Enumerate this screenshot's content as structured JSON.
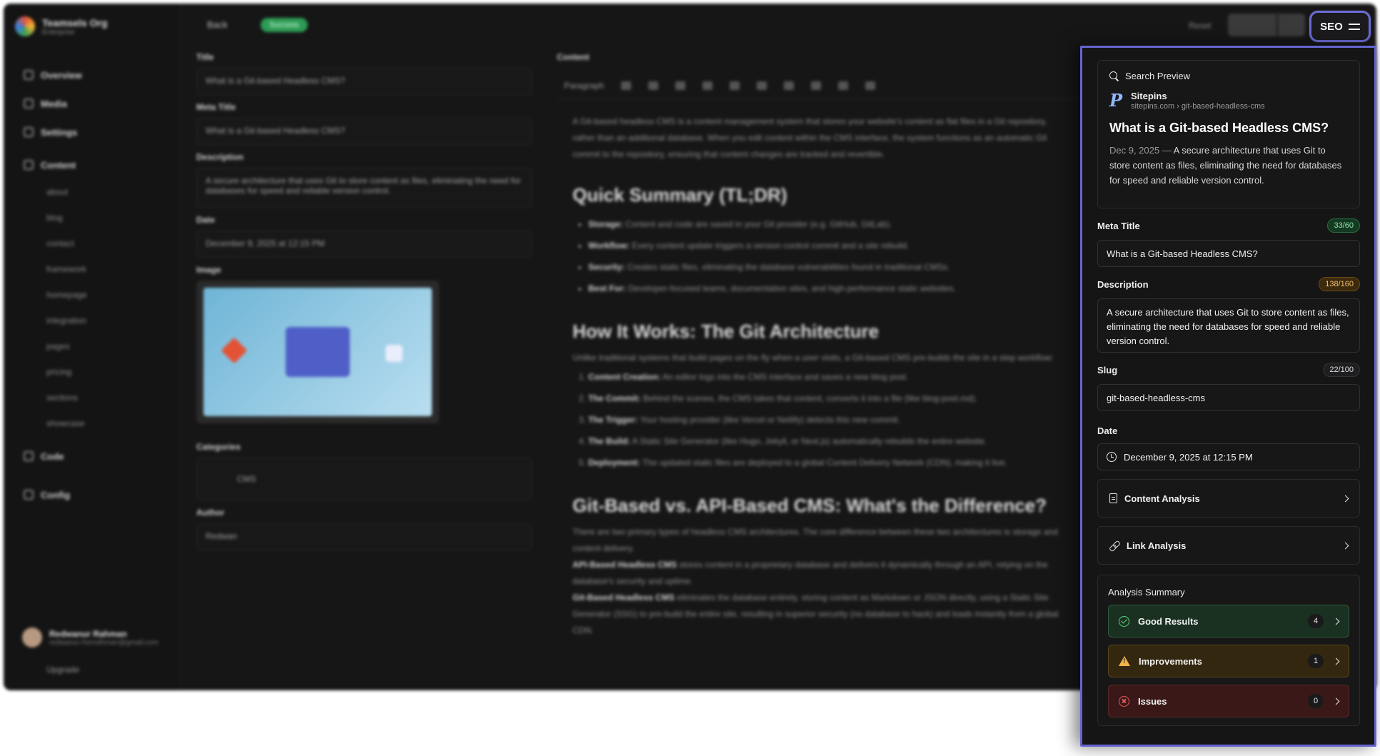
{
  "background": {
    "org_name": "Teamsels Org",
    "org_plan": "Enterprise",
    "nav": [
      "Overview",
      "Media",
      "Settings",
      "Content"
    ],
    "content_pages": [
      "about",
      "blog",
      "contact",
      "framework",
      "homepage",
      "integration",
      "pages",
      "pricing",
      "sections",
      "showcase"
    ],
    "nav_bottom": [
      "Code",
      "Config"
    ],
    "user_name": "Redwanur Rahman",
    "user_email": "redwanur.rhemdhman@gmail.com",
    "upgrade": "Upgrade",
    "back": "Back",
    "status": "Success",
    "reset": "Reset",
    "form": {
      "title_label": "Title",
      "title_value": "What is a Git-based Headless CMS?",
      "meta_title_label": "Meta Title",
      "meta_title_value": "What is a Git-based Headless CMS?",
      "description_label": "Description",
      "description_value": "A secure architecture that uses Git to store content as files, eliminating the need for databases for speed and reliable version control.",
      "date_label": "Date",
      "date_value": "December 9, 2025 at 12:15 PM",
      "image_label": "Image",
      "categories_label": "Categories",
      "category_value": "CMS",
      "author_label": "Author",
      "author_value": "Redwan"
    },
    "editor": {
      "content_label": "Content",
      "paragraph": "Paragraph",
      "intro": "A Git-based headless CMS is a content management system that stores your website's content as flat files in a Git repository, rather than an additional database. When you edit content within the CMS interface, the system functions as an automatic Git commit to the repository, ensuring that content changes are tracked and revertible.",
      "h_summary": "Quick Summary (TL;DR)",
      "summary_items": [
        {
          "k": "Storage:",
          "v": "Content and code are saved in your Git provider (e.g. GitHub, GitLab)."
        },
        {
          "k": "Workflow:",
          "v": "Every content update triggers a version control commit and a site rebuild."
        },
        {
          "k": "Security:",
          "v": "Creates static files, eliminating the database vulnerabilities found in traditional CMSs."
        },
        {
          "k": "Best For:",
          "v": "Developer-focused teams, documentation sites, and high-performance static websites."
        }
      ],
      "h_how": "How It Works: The Git Architecture",
      "how_intro": "Unlike traditional systems that build pages on the fly when a user visits, a Git-based CMS pre-builds the site in a step workflow:",
      "how_items": [
        {
          "k": "Content Creation:",
          "v": "An editor logs into the CMS interface and saves a new blog post."
        },
        {
          "k": "The Commit:",
          "v": "Behind the scenes, the CMS takes that content, converts it into a file (like blog-post.md)."
        },
        {
          "k": "The Trigger:",
          "v": "Your hosting provider (like Vercel or Netlify) detects this new commit."
        },
        {
          "k": "The Build:",
          "v": "A Static Site Generator (like Hugo, Jekyll, or Next.js) automatically rebuilds the entire website."
        },
        {
          "k": "Deployment:",
          "v": "The updated static files are deployed to a global Content Delivery Network (CDN), making it live."
        }
      ],
      "h_vs": "Git-Based vs. API-Based CMS: What's the Difference?",
      "vs_intro": "There are two primary types of headless CMS architectures. The core difference between these two architectures is storage and content delivery.",
      "api_k": "API-Based Headless CMS",
      "api_v": "stores content in a proprietary database and delivers it dynamically through an API, relying on the database's security and uptime.",
      "git_k": "Git-Based Headless CMS",
      "git_v": "eliminates the database entirely, storing content as Markdown or JSON directly, using a Static Site Generator (SSG) to pre-build the entire site, resulting in superior security (no database to hack) and loads instantly from a global CDN."
    }
  },
  "seo_button": {
    "label": "SEO",
    "icon": "sliders-icon"
  },
  "seo": {
    "preview": {
      "heading": "Search Preview",
      "site_name": "Sitepins",
      "site_url": "sitepins.com › git-based-headless-cms",
      "title": "What is a Git-based Headless CMS?",
      "date": "Dec 9, 2025 —",
      "description": "A secure architecture that uses Git to store content as files, eliminating the need for databases for speed and reliable version control."
    },
    "meta_title": {
      "label": "Meta Title",
      "count": "33/60",
      "value": "What is a Git-based Headless CMS?"
    },
    "description": {
      "label": "Description",
      "count": "138/160",
      "value": "A secure architecture that uses Git to store content as files, eliminating the need for databases for speed and reliable version control."
    },
    "slug": {
      "label": "Slug",
      "count": "22/100",
      "value": "git-based-headless-cms"
    },
    "date": {
      "label": "Date",
      "value": "December 9, 2025 at 12:15 PM"
    },
    "content_analysis": "Content Analysis",
    "link_analysis": "Link Analysis",
    "summary": {
      "title": "Analysis Summary",
      "good": {
        "label": "Good Results",
        "count": "4"
      },
      "improvements": {
        "label": "Improvements",
        "count": "1"
      },
      "issues": {
        "label": "Issues",
        "count": "0"
      }
    }
  },
  "colors": {
    "accent": "#6465cf",
    "good": "#5ad07b",
    "warn": "#f0b54a",
    "bad": "#e35b5b"
  }
}
